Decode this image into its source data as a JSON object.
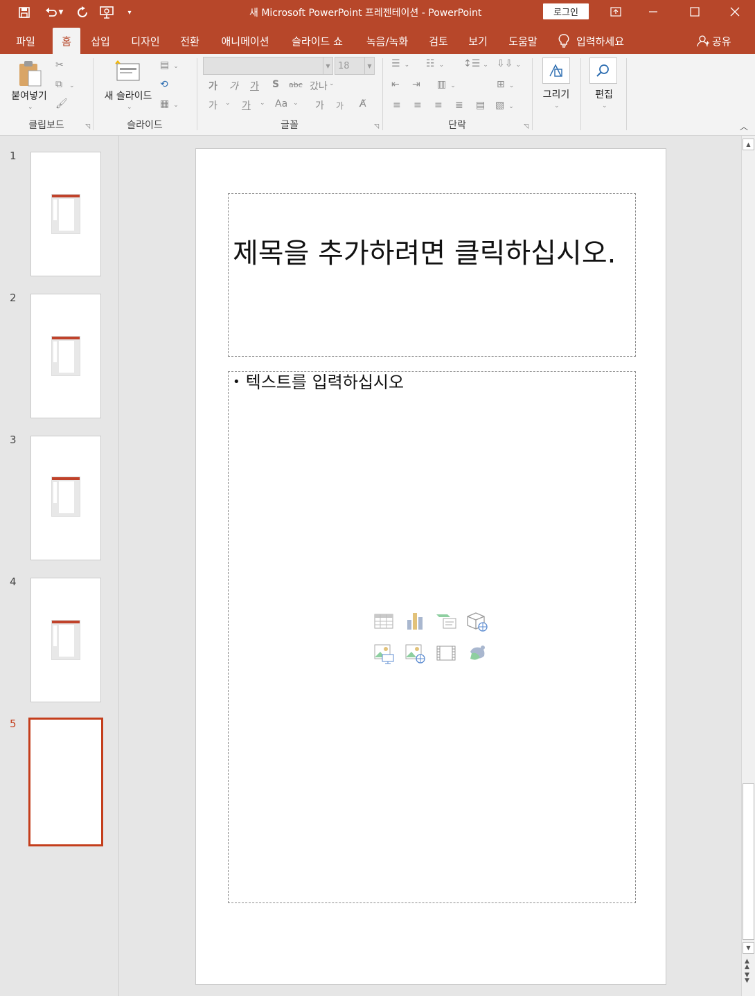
{
  "app": {
    "window_title": "새 Microsoft PowerPoint 프레젠테이션  -  PowerPoint",
    "login_label": "로그인",
    "accent_color": "#b7472a"
  },
  "qat": {
    "items": [
      "save-icon",
      "undo-icon",
      "redo-icon",
      "present-icon",
      "customize-icon"
    ]
  },
  "tabs": [
    {
      "label": "파일",
      "active": false
    },
    {
      "label": "홈",
      "active": true
    },
    {
      "label": "삽입",
      "active": false
    },
    {
      "label": "디자인",
      "active": false
    },
    {
      "label": "전환",
      "active": false
    },
    {
      "label": "애니메이션",
      "active": false
    },
    {
      "label": "슬라이드 쇼",
      "active": false
    },
    {
      "label": "녹음/녹화",
      "active": false
    },
    {
      "label": "검토",
      "active": false
    },
    {
      "label": "보기",
      "active": false
    },
    {
      "label": "도움말",
      "active": false
    }
  ],
  "tellme": {
    "label": "입력하세요",
    "icon": "lightbulb-icon"
  },
  "share": {
    "label": "공유",
    "icon": "person-icon"
  },
  "ribbon": {
    "clipboard": {
      "label": "클립보드",
      "paste_label": "붙여넣기"
    },
    "slides": {
      "label": "슬라이드",
      "new_slide_label": "새 슬라이드"
    },
    "font": {
      "label": "글꼴",
      "font_name": "",
      "font_size": "18",
      "buttons": [
        "가",
        "가",
        "가",
        "S",
        "abc",
        "갔나",
        "가",
        "Aa",
        "가",
        "가"
      ]
    },
    "paragraph": {
      "label": "단락"
    },
    "drawing": {
      "label": "그리기"
    },
    "editing": {
      "label": "편집"
    }
  },
  "thumbnails": [
    {
      "number": "1",
      "current": false
    },
    {
      "number": "2",
      "current": false
    },
    {
      "number": "3",
      "current": false
    },
    {
      "number": "4",
      "current": false
    },
    {
      "number": "5",
      "current": true
    }
  ],
  "slide": {
    "title_placeholder": "제목을 추가하려면 클릭하십시오.",
    "body_placeholder": "텍스트를 입력하십시오",
    "insert_icons": [
      "table-icon",
      "chart-icon",
      "smartart-icon",
      "3d-model-icon",
      "picture-icon",
      "online-picture-icon",
      "video-icon",
      "icons-icon"
    ]
  }
}
